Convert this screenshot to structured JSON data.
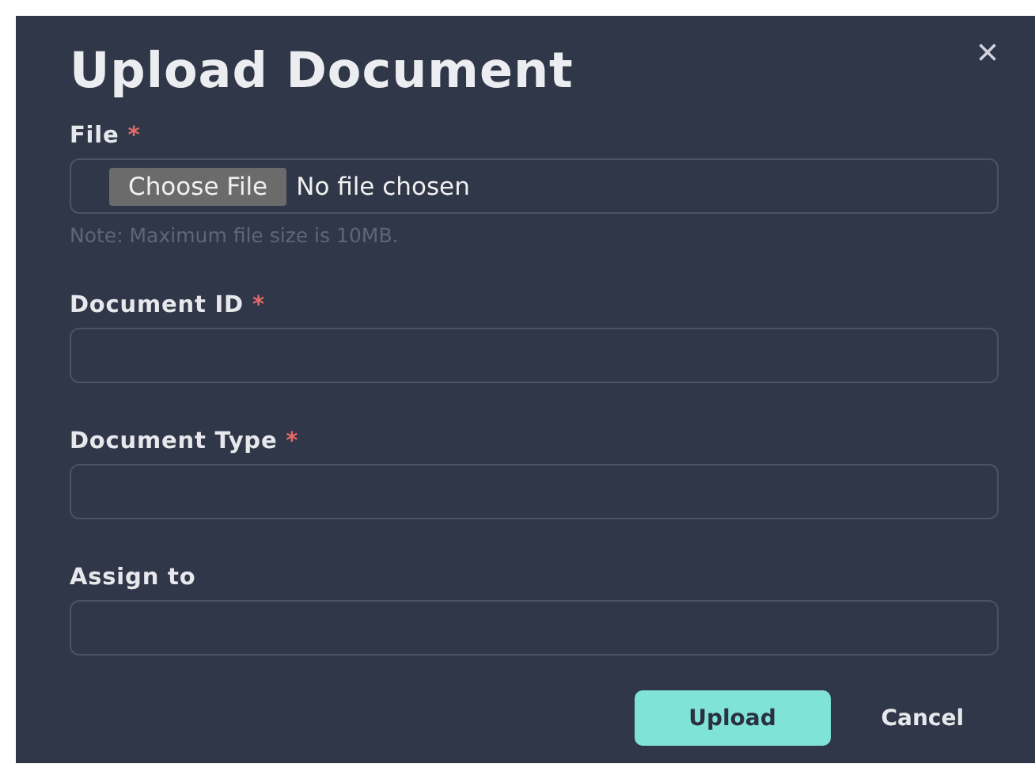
{
  "dialog": {
    "title": "Upload Document",
    "close": "×"
  },
  "fields": [
    {
      "kind": "file",
      "label": "File",
      "required_mark": "*",
      "button": "Choose File",
      "value": "No file chosen",
      "note": "Note: Maximum file size is 10MB."
    },
    {
      "kind": "text",
      "label": "Document ID",
      "required_mark": "*"
    },
    {
      "kind": "text",
      "label": "Document Type",
      "required_mark": "*"
    },
    {
      "kind": "text",
      "label": "Assign to"
    }
  ],
  "buttons": [
    {
      "kind": "primary",
      "label": "Upload"
    },
    {
      "kind": "secondary",
      "label": "Cancel"
    }
  ]
}
